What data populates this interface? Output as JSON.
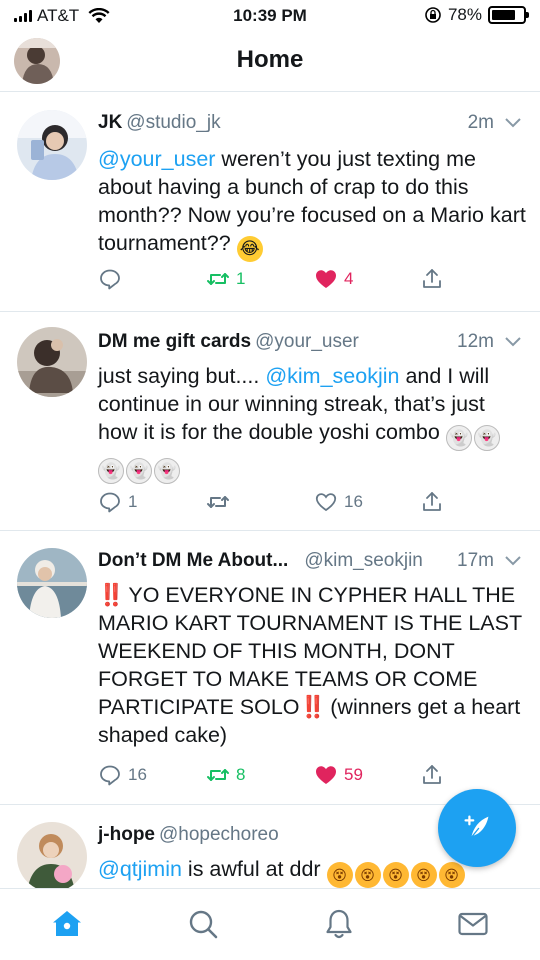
{
  "status_bar": {
    "carrier": "AT&T",
    "time": "10:39 PM",
    "battery": "78%",
    "battery_level": 0.78
  },
  "header": {
    "title": "Home"
  },
  "tweets": [
    {
      "name": "JK",
      "handle": "@studio_jk",
      "time": "2m",
      "text_parts": [
        "@your_user",
        " weren’t you just texting me about having a bunch of crap to do this month?? Now you’re focused on a Mario kart tournament?? "
      ],
      "emoji": [
        "laughing-tears"
      ],
      "replies": "",
      "retweets": "1",
      "likes": "4",
      "retweeted": true,
      "liked": true
    },
    {
      "name": "DM me gift cards",
      "handle": "@your_user",
      "time": "12m",
      "text_parts": [
        "just saying but.... ",
        "@kim_seokjin",
        " and I will continue in our winning streak, that’s just how it is for the double yoshi combo "
      ],
      "emoji": [
        "ghost",
        "ghost",
        "ghost",
        "ghost",
        "ghost"
      ],
      "replies": "1",
      "retweets": "",
      "likes": "16",
      "retweeted": false,
      "liked": false
    },
    {
      "name": "Don’t DM Me About...",
      "handle": "@kim_seokjin",
      "time": "17m",
      "bang": "‼️",
      "text_parts": [
        "YO EVERYONE IN CYPHER HALL THE MARIO KART TOURNAMENT IS THE LAST WEEKEND OF THIS MONTH, DONT FORGET TO MAKE TEAMS OR COME PARTICIPATE SOLO",
        " (winners get a heart shaped cake)"
      ],
      "replies": "16",
      "retweets": "8",
      "likes": "59",
      "retweeted": true,
      "liked": true
    },
    {
      "name": "j-hope",
      "handle": "@hopechoreo",
      "time": "",
      "text_parts": [
        "@qtjimin",
        " is awful at ddr "
      ],
      "emoji": [
        "dizzy-face",
        "dizzy-face",
        "dizzy-face",
        "dizzy-face",
        "dizzy-face"
      ]
    }
  ],
  "tabbar": {
    "items": [
      "home-icon",
      "search-icon",
      "notifications-icon",
      "messages-icon"
    ],
    "active": "home-icon"
  },
  "colors": {
    "accent": "#1da1f2",
    "retweet": "#17bf63",
    "like": "#e0245e",
    "secondary_text": "#657786"
  }
}
